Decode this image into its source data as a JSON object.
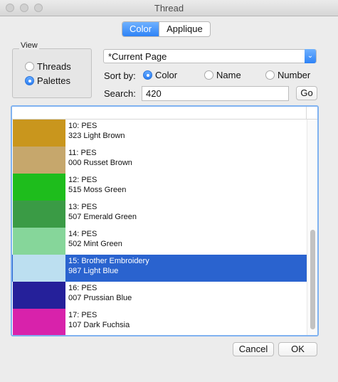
{
  "window": {
    "title": "Thread"
  },
  "tabs": [
    {
      "label": "Color",
      "active": true
    },
    {
      "label": "Applique",
      "active": false
    }
  ],
  "view": {
    "group_label": "View",
    "options": [
      {
        "label": "Threads",
        "checked": false
      },
      {
        "label": "Palettes",
        "checked": true
      }
    ]
  },
  "palette_select": {
    "value": "*Current Page"
  },
  "sort": {
    "label": "Sort by:",
    "options": [
      {
        "label": "Color",
        "checked": true
      },
      {
        "label": "Name",
        "checked": false
      },
      {
        "label": "Number",
        "checked": false
      }
    ]
  },
  "search": {
    "label": "Search:",
    "value": "420",
    "go_label": "Go"
  },
  "threads": [
    {
      "line1": "10: PES",
      "line2": "323 Light Brown",
      "color": "#c9961d",
      "selected": false
    },
    {
      "line1": "11: PES",
      "line2": "000 Russet Brown",
      "color": "#c6a76c",
      "selected": false
    },
    {
      "line1": "12: PES",
      "line2": "515 Moss Green",
      "color": "#1ebd1c",
      "selected": false
    },
    {
      "line1": "13: PES",
      "line2": "507 Emerald Green",
      "color": "#3a9b45",
      "selected": false
    },
    {
      "line1": "14: PES",
      "line2": "502 Mint Green",
      "color": "#86d69a",
      "selected": false
    },
    {
      "line1": "15: Brother Embroidery",
      "line2": "987 Light Blue",
      "color": "#bcdff0",
      "selected": true
    },
    {
      "line1": "16: PES",
      "line2": "007 Prussian Blue",
      "color": "#25209a",
      "selected": false
    },
    {
      "line1": "17: PES",
      "line2": "107 Dark Fuchsia",
      "color": "#d822ab",
      "selected": false
    }
  ],
  "footer": {
    "cancel_label": "Cancel",
    "ok_label": "OK"
  }
}
